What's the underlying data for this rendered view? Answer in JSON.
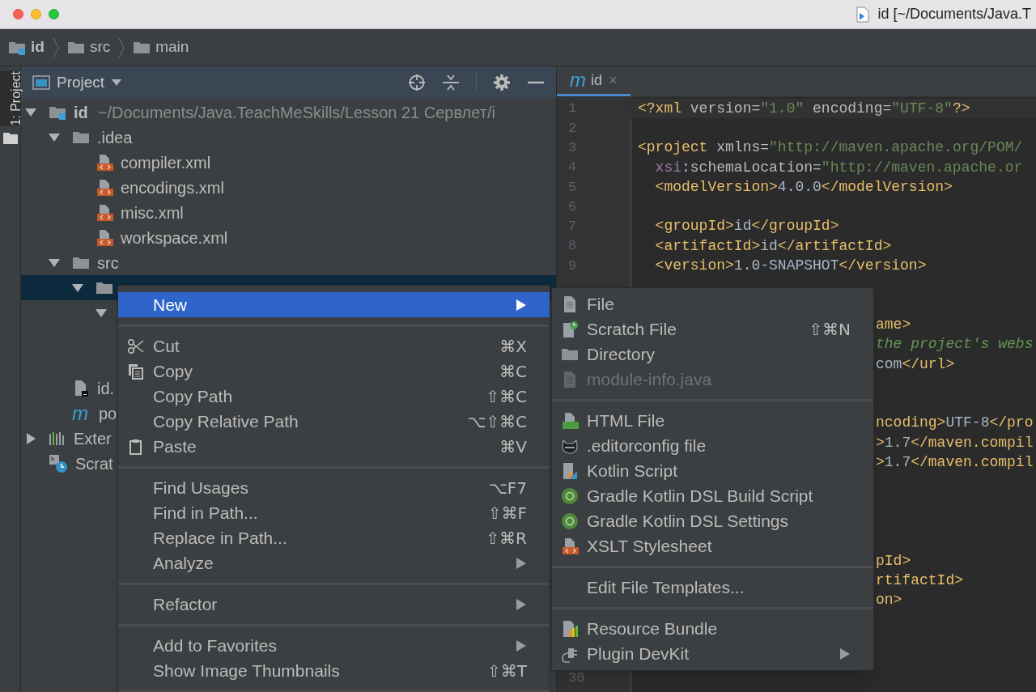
{
  "window": {
    "title": "id [~/Documents/Java.T"
  },
  "breadcrumbs": [
    {
      "kind": "module",
      "label": "id"
    },
    {
      "kind": "folder",
      "label": "src"
    },
    {
      "kind": "folder",
      "label": "main"
    }
  ],
  "tool_strip": [
    {
      "label": "1: Project",
      "selected": true
    }
  ],
  "project_panel": {
    "title": "Project",
    "tree": [
      {
        "kind": "module",
        "label": "id",
        "path": "~/Documents/Java.TeachMeSkills/Lesson 21 Сервлет/i",
        "expanded": true,
        "selected": false,
        "children": [
          {
            "kind": "folder",
            "label": ".idea",
            "expanded": true,
            "selected": false,
            "children": [
              {
                "kind": "xml",
                "label": "compiler.xml",
                "selected": false
              },
              {
                "kind": "xml",
                "label": "encodings.xml",
                "selected": false
              },
              {
                "kind": "xml",
                "label": "misc.xml",
                "selected": false
              },
              {
                "kind": "xml",
                "label": "workspace.xml",
                "selected": false
              }
            ]
          },
          {
            "kind": "folder",
            "label": "src",
            "expanded": true,
            "selected": false,
            "children": [
              {
                "kind": "folder",
                "expanded": true,
                "selected": true,
                "children": [
                  {
                    "expanded": true,
                    "selected": false,
                    "children": [
                      {
                        "selected": false
                      },
                      {
                        "selected": false
                      }
                    ]
                  }
                ]
              }
            ]
          },
          {
            "kind": "iml",
            "label": "id.",
            "selected": false
          },
          {
            "kind": "maven",
            "glyph": "m",
            "label": "po",
            "selected": false
          }
        ]
      },
      {
        "kind": "libraries",
        "label": "Exter",
        "expanded": false,
        "selected": false
      },
      {
        "kind": "scratches",
        "label": "Scrat",
        "selected": false
      }
    ]
  },
  "editor": {
    "tabs": [
      {
        "glyph": "m",
        "label": "id",
        "close": "×",
        "selected": true
      }
    ],
    "lines": [
      {
        "number": "1",
        "current": true,
        "segments": [
          {
            "text": "<?xml",
            "kind": "tag"
          },
          {
            "text": " version=",
            "kind": "attr"
          },
          {
            "text": "\"1.0\"",
            "kind": "value"
          },
          {
            "text": " encoding=",
            "kind": "attr"
          },
          {
            "text": "\"UTF-8\"",
            "kind": "value"
          },
          {
            "text": "?>",
            "kind": "tag"
          }
        ]
      },
      {
        "number": "2",
        "current": false
      },
      {
        "number": "3",
        "current": false,
        "segments": [
          {
            "text": "<project",
            "kind": "tag"
          },
          {
            "text": " xmlns=",
            "kind": "attr"
          },
          {
            "text": "\"http://maven.apache.org/POM/",
            "kind": "value"
          }
        ]
      },
      {
        "number": "4",
        "current": false,
        "segments": [
          {
            "text": "  xsi",
            "kind": "ns"
          },
          {
            "text": ":schemaLocation=",
            "kind": "attr"
          },
          {
            "text": "\"http://maven.apache.or",
            "kind": "value"
          }
        ]
      },
      {
        "number": "5",
        "current": false,
        "segments": [
          {
            "text": "  <modelVersion>",
            "kind": "tag"
          },
          {
            "text": "4.0.0",
            "kind": "text"
          },
          {
            "text": "</modelVersion>",
            "kind": "tag"
          }
        ]
      },
      {
        "number": "6",
        "current": false
      },
      {
        "number": "7",
        "current": false,
        "segments": [
          {
            "text": "  <groupId>",
            "kind": "tag"
          },
          {
            "text": "id",
            "kind": "text"
          },
          {
            "text": "</groupId>",
            "kind": "tag"
          }
        ]
      },
      {
        "number": "8",
        "current": false,
        "segments": [
          {
            "text": "  <artifactId>",
            "kind": "tag"
          },
          {
            "text": "id",
            "kind": "text"
          },
          {
            "text": "</artifactId>",
            "kind": "tag"
          }
        ]
      },
      {
        "number": "9",
        "current": false,
        "segments": [
          {
            "text": "  <version>",
            "kind": "tag"
          },
          {
            "text": "1.0-SNAPSHOT",
            "kind": "text"
          },
          {
            "text": "</version>",
            "kind": "tag"
          }
        ]
      },
      {
        "number": "30",
        "current": false
      }
    ],
    "line_tails": [
      [
        {
          "segments": [
            {
              "text": "ame>",
              "kind": "tag"
            }
          ]
        },
        {
          "segments": [
            {
              "text": "the project's webs",
              "kind": "comment"
            }
          ]
        },
        {
          "segments": [
            {
              "text": "com",
              "kind": "text"
            },
            {
              "text": "</url>",
              "kind": "tag"
            }
          ]
        }
      ],
      [
        {
          "segments": [
            {
              "text": "ncoding>",
              "kind": "tag"
            },
            {
              "text": "UTF-8",
              "kind": "text"
            },
            {
              "text": "</pro",
              "kind": "tag"
            }
          ]
        },
        {
          "segments": [
            {
              "text": ">",
              "kind": "tag"
            },
            {
              "text": "1.7",
              "kind": "text"
            },
            {
              "text": "</maven.compil",
              "kind": "tag"
            }
          ]
        },
        {
          "segments": [
            {
              "text": ">",
              "kind": "tag"
            },
            {
              "text": "1.7",
              "kind": "text"
            },
            {
              "text": "</maven.compil",
              "kind": "tag"
            }
          ]
        }
      ],
      [
        {
          "segments": [
            {
              "text": "pId>",
              "kind": "tag"
            }
          ]
        },
        {
          "segments": [
            {
              "text": "rtifactId>",
              "kind": "tag"
            }
          ]
        },
        {
          "segments": [
            {
              "text": "on>",
              "kind": "tag"
            }
          ]
        }
      ]
    ]
  },
  "context_menu": {
    "items": [
      {
        "kind": "plain",
        "label": "New",
        "submenu": true,
        "selected": true
      },
      {
        "kind": "separator"
      },
      {
        "kind": "scissors",
        "label": "Cut",
        "shortcut": "⌘X",
        "selected": false
      },
      {
        "kind": "copy",
        "label": "Copy",
        "shortcut": "⌘C",
        "selected": false
      },
      {
        "kind": "plain",
        "label": "Copy Path",
        "shortcut": "⇧⌘C",
        "selected": false
      },
      {
        "kind": "plain",
        "label": "Copy Relative Path",
        "shortcut": "⌥⇧⌘C",
        "selected": false
      },
      {
        "kind": "paste",
        "label": "Paste",
        "shortcut": "⌘V",
        "selected": false
      },
      {
        "kind": "separator"
      },
      {
        "kind": "plain",
        "label": "Find Usages",
        "shortcut": "⌥F7",
        "selected": false
      },
      {
        "kind": "plain",
        "label": "Find in Path...",
        "shortcut": "⇧⌘F",
        "selected": false
      },
      {
        "kind": "plain",
        "label": "Replace in Path...",
        "shortcut": "⇧⌘R",
        "selected": false
      },
      {
        "kind": "plain",
        "label": "Analyze",
        "submenu": true,
        "selected": false
      },
      {
        "kind": "separator"
      },
      {
        "kind": "plain",
        "label": "Refactor",
        "submenu": true,
        "selected": false
      },
      {
        "kind": "separator"
      },
      {
        "kind": "plain",
        "label": "Add to Favorites",
        "submenu": true,
        "selected": false
      },
      {
        "kind": "plain",
        "label": "Show Image Thumbnails",
        "shortcut": "⇧⌘T",
        "selected": false
      },
      {
        "kind": "separator"
      }
    ]
  },
  "new_submenu": {
    "items": [
      {
        "kind": "file",
        "label": "File",
        "disabled": false,
        "selected": false
      },
      {
        "kind": "scratch",
        "label": "Scratch File",
        "shortcut": "⇧⌘N",
        "disabled": false,
        "selected": false
      },
      {
        "kind": "folder",
        "label": "Directory",
        "disabled": false,
        "selected": false
      },
      {
        "kind": "file",
        "label": "module-info.java",
        "disabled": true,
        "selected": false
      },
      {
        "kind": "separator"
      },
      {
        "kind": "html",
        "label": "HTML File",
        "disabled": false,
        "selected": false
      },
      {
        "kind": "mascot",
        "label": ".editorconfig file",
        "disabled": false,
        "selected": false
      },
      {
        "kind": "kotlin",
        "label": "Kotlin Script",
        "disabled": false,
        "selected": false
      },
      {
        "kind": "disc",
        "label": "Gradle Kotlin DSL Build Script",
        "disabled": false,
        "selected": false
      },
      {
        "kind": "disc",
        "label": "Gradle Kotlin DSL Settings",
        "disabled": false,
        "selected": false
      },
      {
        "kind": "xml",
        "label": "XSLT Stylesheet",
        "disabled": false,
        "selected": false
      },
      {
        "kind": "separator"
      },
      {
        "kind": "plain",
        "label": "Edit File Templates...",
        "disabled": false,
        "selected": false
      },
      {
        "kind": "separator"
      },
      {
        "kind": "bundle",
        "label": "Resource Bundle",
        "disabled": false,
        "selected": false
      },
      {
        "kind": "plug",
        "label": "Plugin DevKit",
        "submenu": true,
        "disabled": false,
        "selected": false
      }
    ]
  }
}
